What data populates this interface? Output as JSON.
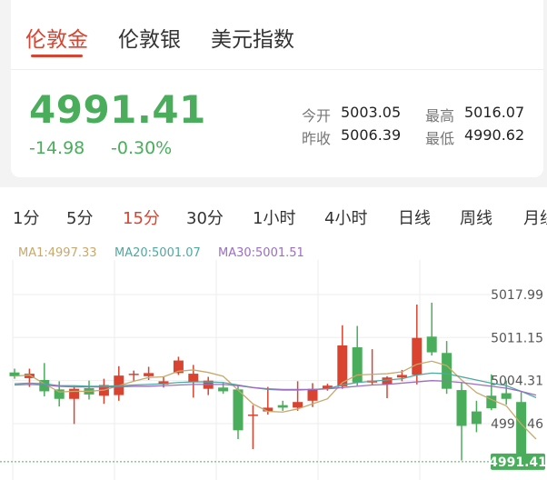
{
  "tabs": [
    {
      "label": "伦敦金",
      "active": true
    },
    {
      "label": "伦敦银",
      "active": false
    },
    {
      "label": "美元指数",
      "active": false
    }
  ],
  "quote": {
    "price": "4991.41",
    "change": "-14.98",
    "change_pct": "-0.30%",
    "open_label": "今开",
    "open": "5003.05",
    "high_label": "最高",
    "high": "5016.07",
    "prev_close_label": "昨收",
    "prev_close": "5006.39",
    "low_label": "最低",
    "low": "4990.62"
  },
  "periods": [
    "1分",
    "5分",
    "15分",
    "30分",
    "1小时",
    "4小时",
    "日线",
    "周线",
    "月线"
  ],
  "active_period": "15分",
  "ma": {
    "ma1": "MA1:4997.33",
    "ma20": "MA20:5001.07",
    "ma30": "MA30:5001.51"
  },
  "colors": {
    "up": "#d9432f",
    "down": "#4aad5b",
    "ma1": "#c8a86b",
    "ma20": "#4fa8a0",
    "ma30": "#9b6ec2"
  },
  "chart_data": {
    "type": "candlestick",
    "y_ticks": [
      "5017.99",
      "5011.15",
      "5004.31",
      "4997.46"
    ],
    "last_price_label": "4991.41",
    "ylim": [
      4990.0,
      5021.0
    ],
    "candles": [
      {
        "o": 5005.6,
        "h": 5006.2,
        "l": 5004.6,
        "c": 5005.0
      },
      {
        "o": 5004.7,
        "h": 5006.2,
        "l": 5003.3,
        "c": 5005.4
      },
      {
        "o": 5004.4,
        "h": 5007.1,
        "l": 5001.8,
        "c": 5002.6
      },
      {
        "o": 5002.9,
        "h": 5004.2,
        "l": 5000.2,
        "c": 5001.4
      },
      {
        "o": 5001.4,
        "h": 5003.5,
        "l": 4997.4,
        "c": 5003.0
      },
      {
        "o": 5003.1,
        "h": 5004.3,
        "l": 5001.3,
        "c": 5002.1
      },
      {
        "o": 5001.9,
        "h": 5004.6,
        "l": 5000.6,
        "c": 5003.6
      },
      {
        "o": 5002.0,
        "h": 5006.6,
        "l": 5001.1,
        "c": 5005.1
      },
      {
        "o": 5005.3,
        "h": 5005.9,
        "l": 5004.2,
        "c": 5005.4
      },
      {
        "o": 5005.0,
        "h": 5006.5,
        "l": 5004.4,
        "c": 5005.5
      },
      {
        "o": 5003.7,
        "h": 5005.0,
        "l": 5003.2,
        "c": 5004.2
      },
      {
        "o": 5005.5,
        "h": 5008.1,
        "l": 5005.2,
        "c": 5007.5
      },
      {
        "o": 5004.1,
        "h": 5006.8,
        "l": 5001.6,
        "c": 5005.4
      },
      {
        "o": 5003.0,
        "h": 5004.9,
        "l": 5002.0,
        "c": 5004.3
      },
      {
        "o": 5003.2,
        "h": 5004.0,
        "l": 5002.2,
        "c": 5002.6
      },
      {
        "o": 5002.9,
        "h": 5003.6,
        "l": 4995.0,
        "c": 4996.4
      },
      {
        "o": 4998.7,
        "h": 5000.4,
        "l": 4993.4,
        "c": 4998.9
      },
      {
        "o": 4999.4,
        "h": 5003.3,
        "l": 4998.9,
        "c": 5000.0
      },
      {
        "o": 5000.4,
        "h": 5001.1,
        "l": 4999.5,
        "c": 5000.0
      },
      {
        "o": 5000.0,
        "h": 5004.2,
        "l": 4999.5,
        "c": 5000.9
      },
      {
        "o": 5001.1,
        "h": 5003.9,
        "l": 5000.1,
        "c": 5003.0
      },
      {
        "o": 5003.0,
        "h": 5003.8,
        "l": 5002.7,
        "c": 5003.5
      },
      {
        "o": 5003.4,
        "h": 5013.1,
        "l": 5003.0,
        "c": 5009.9
      },
      {
        "o": 5009.6,
        "h": 5013.0,
        "l": 5003.5,
        "c": 5004.0
      },
      {
        "o": 5004.0,
        "h": 5009.3,
        "l": 5003.6,
        "c": 5004.3
      },
      {
        "o": 5003.7,
        "h": 5005.0,
        "l": 5001.5,
        "c": 5004.8
      },
      {
        "o": 5004.8,
        "h": 5006.0,
        "l": 5004.2,
        "c": 5005.2
      },
      {
        "o": 5005.2,
        "h": 5016.4,
        "l": 5003.7,
        "c": 5011.1
      },
      {
        "o": 5011.3,
        "h": 5016.7,
        "l": 5008.3,
        "c": 5008.8
      },
      {
        "o": 5008.7,
        "h": 5010.6,
        "l": 5002.2,
        "c": 5003.0
      },
      {
        "o": 5002.8,
        "h": 5004.0,
        "l": 4991.6,
        "c": 4997.1
      },
      {
        "o": 4999.4,
        "h": 5001.1,
        "l": 4996.1,
        "c": 4997.4
      },
      {
        "o": 5001.9,
        "h": 5005.3,
        "l": 4999.6,
        "c": 4999.9
      },
      {
        "o": 5002.3,
        "h": 5004.3,
        "l": 5000.5,
        "c": 5001.4
      },
      {
        "o": 5000.9,
        "h": 5002.5,
        "l": 4991.6,
        "c": 4991.6
      },
      {
        "o": 4991.8,
        "h": 4992.5,
        "l": 4991.1,
        "c": 4991.4
      }
    ],
    "ma1": [
      5005.0,
      5005.2,
      5003.8,
      5002.5,
      5002.6,
      5002.6,
      5002.8,
      5003.5,
      5004.2,
      5004.8,
      5004.9,
      5005.8,
      5006.0,
      5005.6,
      5005.0,
      5002.8,
      5000.6,
      4999.4,
      4999.3,
      4999.8,
      5000.6,
      5001.4,
      5004.0,
      5005.2,
      5005.3,
      5005.4,
      5005.7,
      5006.9,
      5007.4,
      5006.7,
      5004.4,
      5002.4,
      5001.3,
      5000.3,
      4997.4,
      4995.0
    ],
    "ma20": [
      5003.8,
      5003.9,
      5003.8,
      5003.5,
      5003.5,
      5003.4,
      5003.4,
      5003.5,
      5003.6,
      5003.7,
      5003.8,
      5004.0,
      5004.1,
      5004.1,
      5004.0,
      5003.6,
      5003.2,
      5002.9,
      5002.8,
      5002.8,
      5002.9,
      5003.0,
      5003.6,
      5004.0,
      5004.2,
      5004.4,
      5004.6,
      5005.2,
      5005.5,
      5005.4,
      5004.9,
      5004.4,
      5003.9,
      5003.5,
      5002.6,
      5001.6
    ],
    "ma30": [
      5003.6,
      5003.7,
      5003.6,
      5003.4,
      5003.3,
      5003.3,
      5003.3,
      5003.3,
      5003.4,
      5003.4,
      5003.5,
      5003.6,
      5003.7,
      5003.7,
      5003.7,
      5003.5,
      5003.2,
      5003.0,
      5002.9,
      5002.9,
      5002.9,
      5003.0,
      5003.2,
      5003.4,
      5003.6,
      5003.7,
      5003.9,
      5004.1,
      5004.3,
      5004.2,
      5004.0,
      5003.7,
      5003.4,
      5003.1,
      5002.6,
      5002.0
    ]
  }
}
